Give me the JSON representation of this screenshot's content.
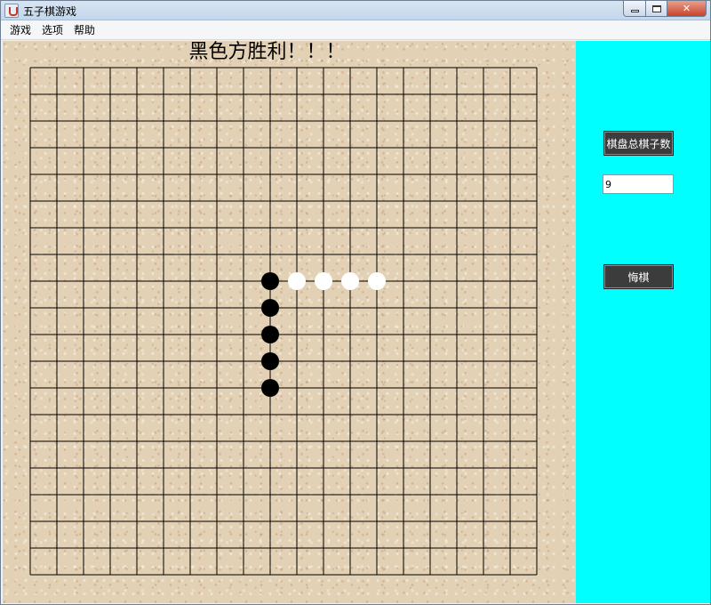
{
  "window": {
    "title": "五子棋游戏"
  },
  "menu": {
    "items": [
      "游戏",
      "选项",
      "帮助"
    ]
  },
  "board": {
    "status_text": "黑色方胜利！！！",
    "grid_size": 20,
    "black_stones": [
      [
        9,
        8
      ],
      [
        9,
        9
      ],
      [
        9,
        10
      ],
      [
        9,
        11
      ],
      [
        9,
        12
      ]
    ],
    "white_stones": [
      [
        10,
        8
      ],
      [
        11,
        8
      ],
      [
        12,
        8
      ],
      [
        13,
        8
      ]
    ],
    "colors": {
      "line": "#000000",
      "black": "#000000",
      "white": "#ffffff",
      "panel": "#00ffff"
    }
  },
  "side_panel": {
    "count_button_label": "棋盘总棋子数",
    "count_value": "9",
    "undo_button_label": "悔棋"
  },
  "icons": {
    "app": "java-icon",
    "minimize": "minimize-icon",
    "maximize": "maximize-icon",
    "close": "close-icon"
  }
}
